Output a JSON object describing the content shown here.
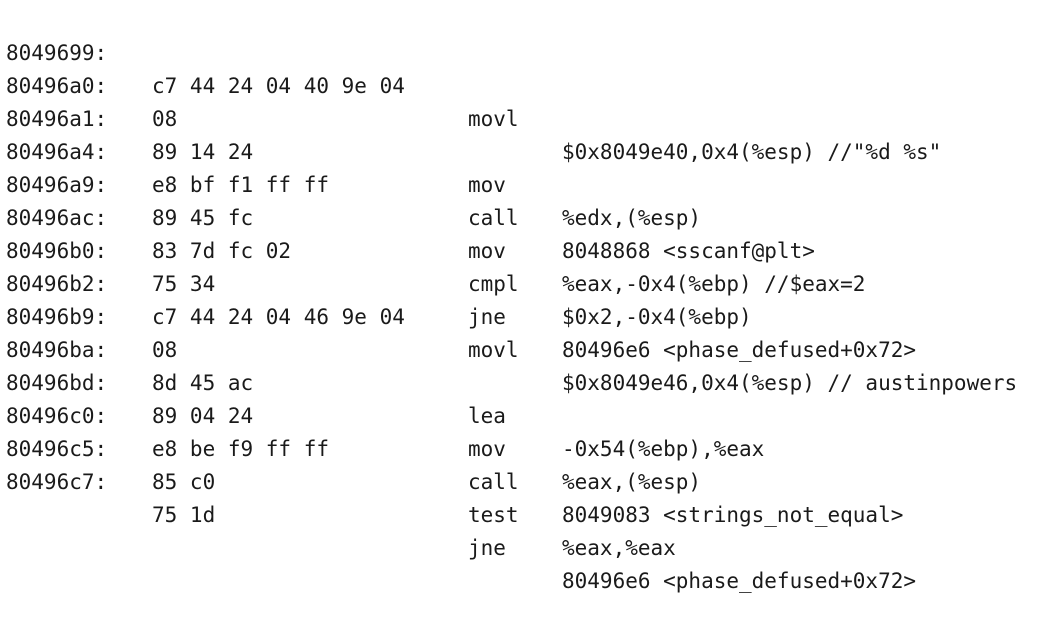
{
  "disassembly": {
    "rows": [
      {
        "addr": "8049699:",
        "bytes": "c7 44 24 04 40 9e 04",
        "mnemonic": "movl",
        "operands": "$0x8049e40,0x4(%esp) //\"%d %s\""
      },
      {
        "addr": "80496a0:",
        "bytes": "08",
        "mnemonic": "",
        "operands": ""
      },
      {
        "addr": "80496a1:",
        "bytes": "89 14 24",
        "mnemonic": "mov",
        "operands": "%edx,(%esp)"
      },
      {
        "addr": "80496a4:",
        "bytes": "e8 bf f1 ff ff",
        "mnemonic": "call",
        "operands": "8048868 <sscanf@plt>"
      },
      {
        "addr": "80496a9:",
        "bytes": "89 45 fc",
        "mnemonic": "mov",
        "operands": "%eax,-0x4(%ebp) //$eax=2"
      },
      {
        "addr": "80496ac:",
        "bytes": "83 7d fc 02",
        "mnemonic": "cmpl",
        "operands": "$0x2,-0x4(%ebp)"
      },
      {
        "addr": "80496b0:",
        "bytes": "75 34",
        "mnemonic": "jne",
        "operands": "80496e6 <phase_defused+0x72>"
      },
      {
        "addr": "80496b2:",
        "bytes": "c7 44 24 04 46 9e 04",
        "mnemonic": "movl",
        "operands": "$0x8049e46,0x4(%esp) // austinpowers"
      },
      {
        "addr": "80496b9:",
        "bytes": "08",
        "mnemonic": "",
        "operands": ""
      },
      {
        "addr": "80496ba:",
        "bytes": "8d 45 ac",
        "mnemonic": "lea",
        "operands": "-0x54(%ebp),%eax"
      },
      {
        "addr": "80496bd:",
        "bytes": "89 04 24",
        "mnemonic": "mov",
        "operands": "%eax,(%esp)"
      },
      {
        "addr": "80496c0:",
        "bytes": "e8 be f9 ff ff",
        "mnemonic": "call",
        "operands": "8049083 <strings_not_equal>"
      },
      {
        "addr": "80496c5:",
        "bytes": "85 c0",
        "mnemonic": "test",
        "operands": "%eax,%eax"
      },
      {
        "addr": "80496c7:",
        "bytes": "75 1d",
        "mnemonic": "jne",
        "operands": "80496e6 <phase_defused+0x72>"
      }
    ]
  }
}
